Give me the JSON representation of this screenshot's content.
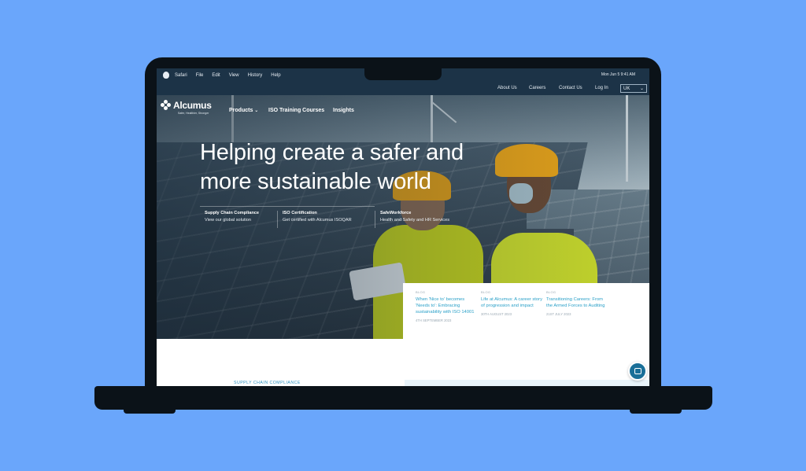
{
  "menubar": {
    "items": [
      "Safari",
      "File",
      "Edit",
      "View",
      "History",
      "Help"
    ],
    "clock": "Mon Jun 5  9:41 AM"
  },
  "utility": {
    "links": [
      "About Us",
      "Careers",
      "Contact Us",
      "Log In"
    ],
    "language": "UK"
  },
  "brand": {
    "name": "Alcumus",
    "tagline": "Safer, Healthier, Stronger"
  },
  "nav": {
    "products": "Products",
    "training": "ISO Training Courses",
    "insights": "Insights"
  },
  "hero": {
    "headline_line1": "Helping create a safer and",
    "headline_line2": "more sustainable world"
  },
  "cards": [
    {
      "title": "Supply Chain Compliance",
      "subtitle": "View our global solution"
    },
    {
      "title": "ISO Certification",
      "subtitle": "Get certified with Alcumus ISOQAR"
    },
    {
      "title": "SafeWorkforce",
      "subtitle": "Health and Safety and HR Services"
    }
  ],
  "blog": [
    {
      "tag": "BLOG",
      "title": "When 'Nice to' becomes 'Needs to': Embracing sustainability with ISO 14001",
      "date": "4TH SEPTEMBER 2023"
    },
    {
      "tag": "BLOG",
      "title": "Life at Alcumus: A career story of progression and impact",
      "date": "30TH AUGUST 2023"
    },
    {
      "tag": "BLOG",
      "title": "Transitioning Careers: From the Armed Forces to Auditing",
      "date": "21ST JULY 2023"
    }
  ],
  "section": {
    "label": "SUPPLY CHAIN COMPLIANCE"
  },
  "colors": {
    "background": "#6aa6fb",
    "navy": "#1c3347",
    "accent_link": "#2aa0c8",
    "vest": "#cfe02b",
    "hat": "#f0a817"
  }
}
